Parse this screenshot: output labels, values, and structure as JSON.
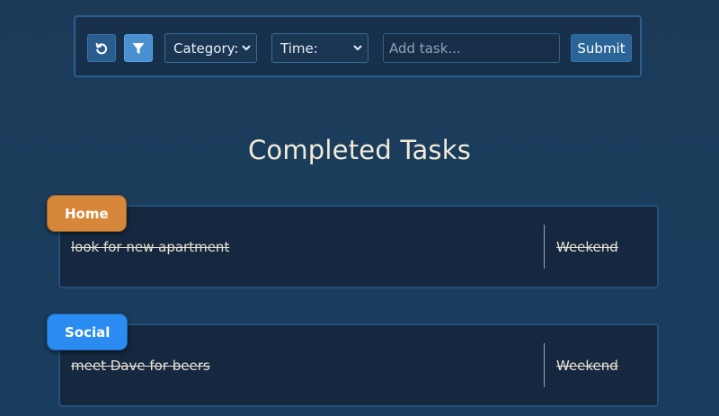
{
  "toolbar": {
    "reset_icon": "refresh-icon",
    "filter_icon": "filter-icon",
    "category_select": "Category:",
    "time_select": "Time:",
    "task_input_placeholder": "Add task...",
    "task_input_value": "",
    "submit_label": "Submit"
  },
  "main": {
    "title": "Completed Tasks",
    "tasks": [
      {
        "category": "Home",
        "text": "look for new apartment",
        "time": "Weekend",
        "badge_color": "#d6873a"
      },
      {
        "category": "Social",
        "text": "meet Dave for beers",
        "time": "Weekend",
        "badge_color": "#2a8cf0"
      }
    ]
  },
  "colors": {
    "background": "#1b3a58",
    "card_background": "#15283f",
    "card_border": "#23507a",
    "accent": "#4a8fcf"
  }
}
